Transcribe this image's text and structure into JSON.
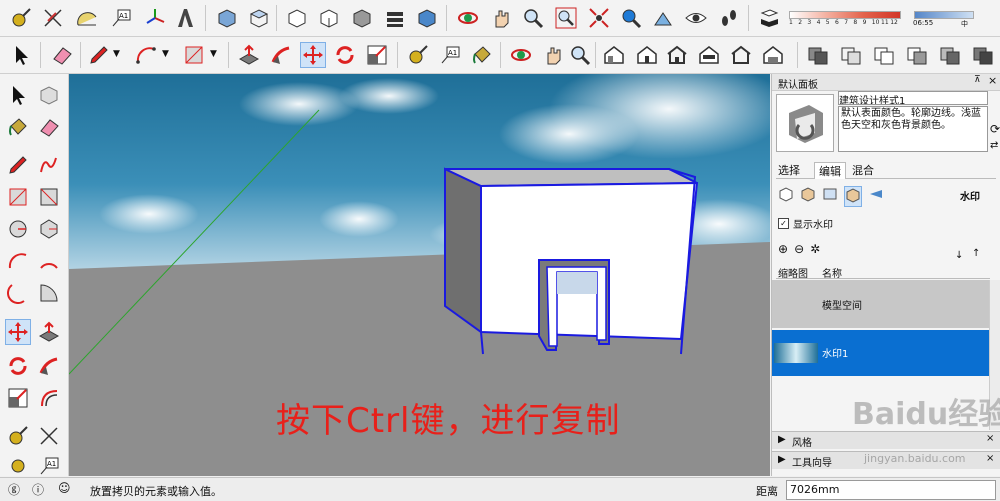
{
  "colors": {
    "toolbar_bg": "#f3f3f3",
    "selection_blue": "#0a6fd1",
    "caption_red": "#e8201a",
    "ground_gray": "#8e8e8e",
    "model_edge_blue": "#1a1ae0"
  },
  "toolbar_top": {
    "icons": [
      "tape-measure-icon",
      "protractor-axes-icon",
      "protractor-icon",
      "text-label-icon",
      "axes-icon",
      "3d-text-icon",
      "iso-view-icon",
      "top-view-icon",
      "front-view-icon",
      "right-view-icon",
      "back-view-icon",
      "left-view-icon",
      "orbit-icon",
      "pan-icon",
      "zoom-icon",
      "zoom-window-icon",
      "zoom-extents-icon",
      "previous-view-icon",
      "look-around-icon",
      "walk-icon",
      "shadow-icon"
    ],
    "shadow_scale_labels": [
      "1",
      "2",
      "3",
      "4",
      "5",
      "6",
      "7",
      "8",
      "9",
      "10",
      "11",
      "12"
    ],
    "shadow_time": "06:55",
    "shadow_mode": "中"
  },
  "toolbar_second": {
    "icons": [
      "select-arrow-icon",
      "eraser-icon",
      "pencil-line-icon",
      "arc-icon",
      "rectangle-icon",
      "push-pull-icon",
      "follow-me-icon",
      "move-icon",
      "rotate-icon",
      "scale-icon",
      "tape-icon",
      "text-icon",
      "paint-bucket-icon",
      "orbit-icon",
      "pan-icon",
      "zoom-icon",
      "house-warehouse-icon",
      "house-icon",
      "house-outline-icon",
      "house-front-icon",
      "house-simple-icon",
      "house-roof-icon",
      "xray-style-icon",
      "wireframe-style-icon",
      "hidden-line-style-icon",
      "shaded-style-icon",
      "textured-style-icon",
      "monochrome-style-icon"
    ]
  },
  "left_toolbar": {
    "icons": [
      "select-arrow-icon",
      "component-icon",
      "paint-bucket-icon",
      "eraser-icon",
      "pencil-line-icon",
      "freehand-icon",
      "rectangle-icon",
      "rotated-rectangle-icon",
      "circle-icon",
      "polygon-icon",
      "arc-icon",
      "two-point-arc-icon",
      "three-point-arc-icon",
      "pie-icon",
      "move-icon",
      "push-pull-icon",
      "rotate-icon",
      "follow-me-icon",
      "scale-icon",
      "offset-icon",
      "tape-measure-icon",
      "axes-icon",
      "dimension-icon",
      "text-label-icon"
    ]
  },
  "viewport": {
    "caption": "按下Ctrl键，进行复制"
  },
  "tray": {
    "title": "默认面板",
    "style_name": "建筑设计样式1",
    "style_desc": "默认表面颜色。轮廓边线。浅蓝色天空和灰色背景颜色。",
    "tabs": [
      "选择",
      "编辑",
      "混合"
    ],
    "active_tab": "编辑",
    "section_label": "水印",
    "show_watermark_label": "显示水印",
    "show_watermark_checked": true,
    "col_thumb": "缩略图",
    "col_name": "名称",
    "rows": [
      {
        "name": "模型空间",
        "selected": false
      },
      {
        "name": "水印1",
        "selected": true
      }
    ],
    "collapsed_panels": [
      "风格",
      "工具向导"
    ]
  },
  "watermark": {
    "brand": "Baidu经验",
    "url": "jingyan.baidu.com"
  },
  "status": {
    "message": "放置拷贝的元素或输入值。",
    "measure_label": "距离",
    "measure_value": "7026mm"
  }
}
